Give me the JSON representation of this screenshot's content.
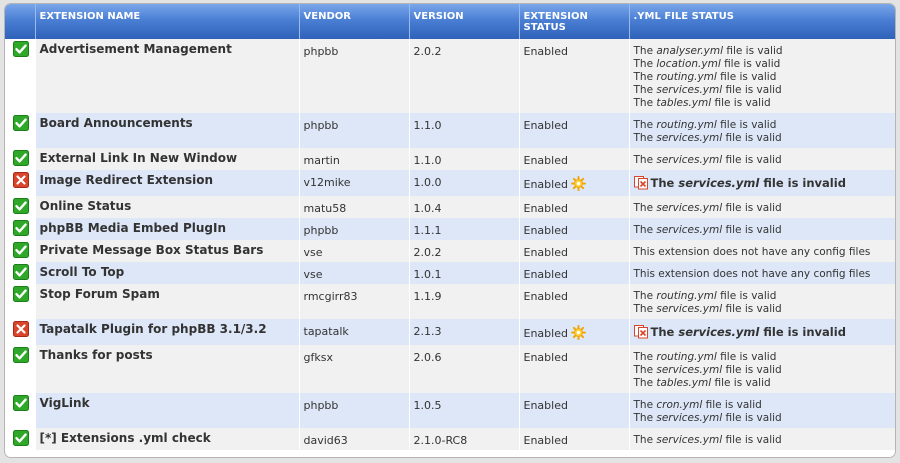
{
  "table": {
    "headers": {
      "icon": "",
      "name": "EXTENSION NAME",
      "vendor": "VENDOR",
      "version": "VERSION",
      "status": "EXTENSION STATUS",
      "yml": ".YML FILE STATUS"
    },
    "rows": [
      {
        "valid": true,
        "name": "Advertisement Management",
        "vendor": "phpbb",
        "version": "2.0.2",
        "status": "Enabled",
        "yml": {
          "kind": "files",
          "lines": [
            [
              "The ",
              "analyser.yml",
              " file is valid"
            ],
            [
              "The ",
              "location.yml",
              " file is valid"
            ],
            [
              "The ",
              "routing.yml",
              " file is valid"
            ],
            [
              "The ",
              "services.yml",
              " file is valid"
            ],
            [
              "The ",
              "tables.yml",
              " file is valid"
            ]
          ]
        }
      },
      {
        "valid": true,
        "name": "Board Announcements",
        "vendor": "phpbb",
        "version": "1.1.0",
        "status": "Enabled",
        "yml": {
          "kind": "files",
          "lines": [
            [
              "The ",
              "routing.yml",
              " file is valid"
            ],
            [
              "The ",
              "services.yml",
              " file is valid"
            ]
          ]
        }
      },
      {
        "valid": true,
        "name": "External Link In New Window",
        "vendor": "martin",
        "version": "1.1.0",
        "status": "Enabled",
        "yml": {
          "kind": "files",
          "lines": [
            [
              "The ",
              "services.yml",
              " file is valid"
            ]
          ]
        }
      },
      {
        "valid": false,
        "name": "Image Redirect Extension",
        "vendor": "v12mike",
        "version": "1.0.0",
        "status": "Enabled",
        "yml": {
          "kind": "invalid",
          "lines": [
            [
              "The ",
              "services.yml",
              " file is invalid"
            ]
          ]
        }
      },
      {
        "valid": true,
        "name": "Online Status",
        "vendor": "matu58",
        "version": "1.0.4",
        "status": "Enabled",
        "yml": {
          "kind": "files",
          "lines": [
            [
              "The ",
              "services.yml",
              " file is valid"
            ]
          ]
        }
      },
      {
        "valid": true,
        "name": "phpBB Media Embed PlugIn",
        "vendor": "phpbb",
        "version": "1.1.1",
        "status": "Enabled",
        "yml": {
          "kind": "files",
          "lines": [
            [
              "The ",
              "services.yml",
              " file is valid"
            ]
          ]
        }
      },
      {
        "valid": true,
        "name": "Private Message Box Status Bars",
        "vendor": "vse",
        "version": "2.0.2",
        "status": "Enabled",
        "yml": {
          "kind": "text",
          "lines": [
            [
              "This extension does not have any config files",
              "",
              ""
            ]
          ]
        }
      },
      {
        "valid": true,
        "name": "Scroll To Top",
        "vendor": "vse",
        "version": "1.0.1",
        "status": "Enabled",
        "yml": {
          "kind": "text",
          "lines": [
            [
              "This extension does not have any config files",
              "",
              ""
            ]
          ]
        }
      },
      {
        "valid": true,
        "name": "Stop Forum Spam",
        "vendor": "rmcgirr83",
        "version": "1.1.9",
        "status": "Enabled",
        "yml": {
          "kind": "files",
          "lines": [
            [
              "The ",
              "routing.yml",
              " file is valid"
            ],
            [
              "The ",
              "services.yml",
              " file is valid"
            ]
          ]
        }
      },
      {
        "valid": false,
        "name": "Tapatalk Plugin for phpBB 3.1/3.2",
        "vendor": "tapatalk",
        "version": "2.1.3",
        "status": "Enabled",
        "yml": {
          "kind": "invalid",
          "lines": [
            [
              "The ",
              "services.yml",
              " file is invalid"
            ]
          ]
        }
      },
      {
        "valid": true,
        "name": "Thanks for posts",
        "vendor": "gfksx",
        "version": "2.0.6",
        "status": "Enabled",
        "yml": {
          "kind": "files",
          "lines": [
            [
              "The ",
              "routing.yml",
              " file is valid"
            ],
            [
              "The ",
              "services.yml",
              " file is valid"
            ],
            [
              "The ",
              "tables.yml",
              " file is valid"
            ]
          ]
        }
      },
      {
        "valid": true,
        "name": "VigLink",
        "vendor": "phpbb",
        "version": "1.0.5",
        "status": "Enabled",
        "yml": {
          "kind": "files",
          "lines": [
            [
              "The ",
              "cron.yml",
              " file is valid"
            ],
            [
              "The ",
              "services.yml",
              " file is valid"
            ]
          ]
        }
      },
      {
        "valid": true,
        "name": "[*] Extensions .yml check",
        "vendor": "david63",
        "version": "2.1.0-RC8",
        "status": "Enabled",
        "yml": {
          "kind": "files",
          "lines": [
            [
              "The ",
              "services.yml",
              " file is valid"
            ]
          ]
        }
      }
    ]
  },
  "icons": {
    "valid": "green-check-icon",
    "invalid": "red-cross-icon",
    "warning": "gear-sun-warning-icon",
    "invalid_file": "invalid-file-icon"
  },
  "colors": {
    "header_top": "#7aa6ea",
    "header_bottom": "#2f62b9",
    "row_alt": "#dde7f8",
    "row_base": "#f1f1f1",
    "valid_green": "#2fa82a",
    "invalid_red": "#d9452b"
  }
}
